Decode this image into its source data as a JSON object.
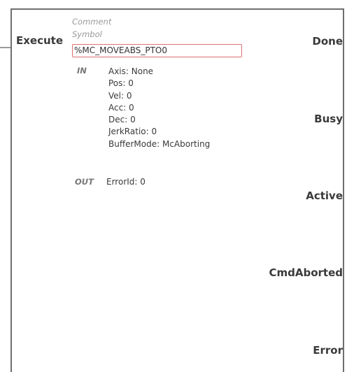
{
  "block": {
    "input_pin": "Execute",
    "comment_label": "Comment",
    "symbol_label": "Symbol",
    "symbol_value": "%MC_MOVEABS_PTO0",
    "in_label": "IN",
    "out_label": "OUT",
    "inputs": [
      "Axis: None",
      "Pos: 0",
      "Vel: 0",
      "Acc: 0",
      "Dec: 0",
      "JerkRatio: 0",
      "BufferMode: McAborting"
    ],
    "outputs_params": [
      "ErrorId: 0"
    ],
    "output_pins": [
      "Done",
      "Busy",
      "Active",
      "CmdAborted",
      "Error"
    ]
  }
}
